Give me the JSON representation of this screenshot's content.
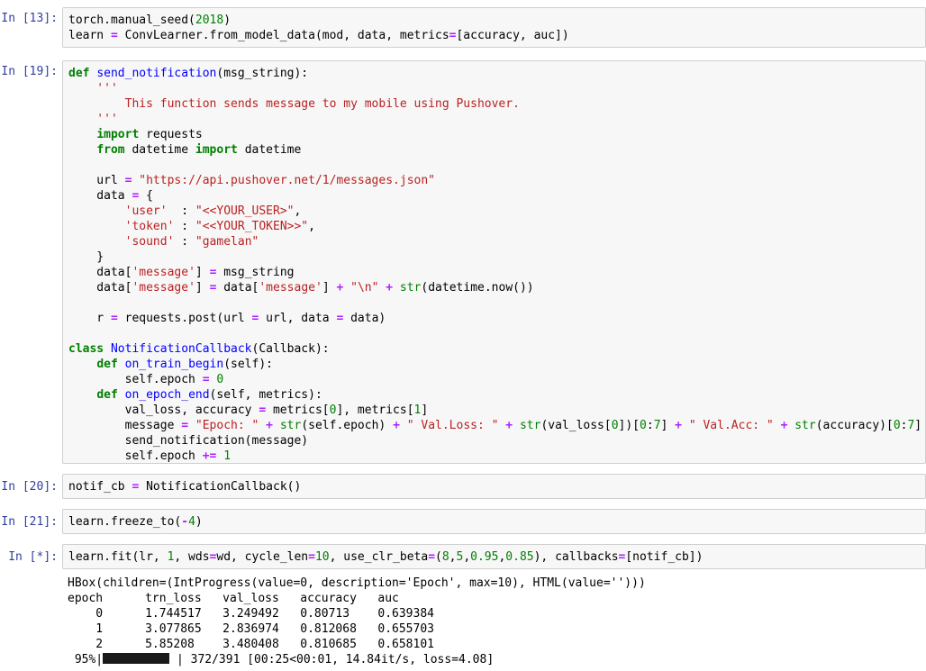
{
  "cells": [
    {
      "prompt": "In [13]:",
      "lines": [
        [
          [
            "",
            "torch.manual_seed("
          ],
          [
            "num",
            "2018"
          ],
          [
            "",
            ")"
          ]
        ],
        [
          [
            "",
            "learn "
          ],
          [
            "op",
            "="
          ],
          [
            "",
            " ConvLearner.from_model_data(mod, data, metrics"
          ],
          [
            "op",
            "="
          ],
          [
            "",
            "[accuracy, auc])"
          ]
        ]
      ]
    },
    {
      "prompt": "In [19]:",
      "lines": [
        [
          [
            "kw",
            "def"
          ],
          [
            "",
            " "
          ],
          [
            "nm",
            "send_notification"
          ],
          [
            "",
            "(msg_string):"
          ]
        ],
        [
          [
            "st",
            "    '''"
          ]
        ],
        [
          [
            "st",
            "        This function sends message to my mobile using Pushover."
          ]
        ],
        [
          [
            "st",
            "    '''"
          ]
        ],
        [
          [
            "",
            "    "
          ],
          [
            "kw",
            "import"
          ],
          [
            "",
            " requests"
          ]
        ],
        [
          [
            "",
            "    "
          ],
          [
            "kw",
            "from"
          ],
          [
            "",
            " datetime "
          ],
          [
            "kw",
            "import"
          ],
          [
            "",
            " datetime"
          ]
        ],
        [
          [
            "",
            ""
          ]
        ],
        [
          [
            "",
            "    url "
          ],
          [
            "op",
            "="
          ],
          [
            "",
            " "
          ],
          [
            "st",
            "\"https://api.pushover.net/1/messages.json\""
          ]
        ],
        [
          [
            "",
            "    data "
          ],
          [
            "op",
            "="
          ],
          [
            "",
            " {"
          ]
        ],
        [
          [
            "",
            "        "
          ],
          [
            "st",
            "'user'"
          ],
          [
            "",
            "  : "
          ],
          [
            "st",
            "\"<<YOUR_USER>\""
          ],
          [
            "",
            ","
          ]
        ],
        [
          [
            "",
            "        "
          ],
          [
            "st",
            "'token'"
          ],
          [
            "",
            " : "
          ],
          [
            "st",
            "\"<<YOUR_TOKEN>>\""
          ],
          [
            "",
            ","
          ]
        ],
        [
          [
            "",
            "        "
          ],
          [
            "st",
            "'sound'"
          ],
          [
            "",
            " : "
          ],
          [
            "st",
            "\"gamelan\""
          ]
        ],
        [
          [
            "",
            "    }"
          ]
        ],
        [
          [
            "",
            "    data["
          ],
          [
            "st",
            "'message'"
          ],
          [
            "",
            "] "
          ],
          [
            "op",
            "="
          ],
          [
            "",
            " msg_string"
          ]
        ],
        [
          [
            "",
            "    data["
          ],
          [
            "st",
            "'message'"
          ],
          [
            "",
            "] "
          ],
          [
            "op",
            "="
          ],
          [
            "",
            " data["
          ],
          [
            "st",
            "'message'"
          ],
          [
            "",
            "] "
          ],
          [
            "op",
            "+"
          ],
          [
            "",
            " "
          ],
          [
            "st",
            "\"\\n\""
          ],
          [
            "",
            " "
          ],
          [
            "op",
            "+"
          ],
          [
            "",
            " "
          ],
          [
            "bi",
            "str"
          ],
          [
            "",
            "(datetime.now())"
          ]
        ],
        [
          [
            "",
            ""
          ]
        ],
        [
          [
            "",
            "    r "
          ],
          [
            "op",
            "="
          ],
          [
            "",
            " requests.post(url "
          ],
          [
            "op",
            "="
          ],
          [
            "",
            " url, data "
          ],
          [
            "op",
            "="
          ],
          [
            "",
            " data)"
          ]
        ],
        [
          [
            "",
            ""
          ]
        ],
        [
          [
            "kw",
            "class"
          ],
          [
            "",
            " "
          ],
          [
            "cl",
            "NotificationCallback"
          ],
          [
            "",
            "(Callback):"
          ]
        ],
        [
          [
            "",
            "    "
          ],
          [
            "kw",
            "def"
          ],
          [
            "",
            " "
          ],
          [
            "nm",
            "on_train_begin"
          ],
          [
            "",
            "(self):"
          ]
        ],
        [
          [
            "",
            "        self.epoch "
          ],
          [
            "op",
            "="
          ],
          [
            "",
            " "
          ],
          [
            "num",
            "0"
          ]
        ],
        [
          [
            "",
            "    "
          ],
          [
            "kw",
            "def"
          ],
          [
            "",
            " "
          ],
          [
            "nm",
            "on_epoch_end"
          ],
          [
            "",
            "(self, metrics):"
          ]
        ],
        [
          [
            "",
            "        val_loss, accuracy "
          ],
          [
            "op",
            "="
          ],
          [
            "",
            " metrics["
          ],
          [
            "num",
            "0"
          ],
          [
            "",
            "], metrics["
          ],
          [
            "num",
            "1"
          ],
          [
            "",
            "]"
          ]
        ],
        [
          [
            "",
            "        message "
          ],
          [
            "op",
            "="
          ],
          [
            "",
            " "
          ],
          [
            "st",
            "\"Epoch: \""
          ],
          [
            "",
            " "
          ],
          [
            "op",
            "+"
          ],
          [
            "",
            " "
          ],
          [
            "bi",
            "str"
          ],
          [
            "",
            "(self.epoch) "
          ],
          [
            "op",
            "+"
          ],
          [
            "",
            " "
          ],
          [
            "st",
            "\" Val.Loss: \""
          ],
          [
            "",
            " "
          ],
          [
            "op",
            "+"
          ],
          [
            "",
            " "
          ],
          [
            "bi",
            "str"
          ],
          [
            "",
            "(val_loss["
          ],
          [
            "num",
            "0"
          ],
          [
            "",
            "])["
          ],
          [
            "num",
            "0"
          ],
          [
            "",
            ":"
          ],
          [
            "num",
            "7"
          ],
          [
            "",
            "] "
          ],
          [
            "op",
            "+"
          ],
          [
            "",
            " "
          ],
          [
            "st",
            "\" Val.Acc: \""
          ],
          [
            "",
            " "
          ],
          [
            "op",
            "+"
          ],
          [
            "",
            " "
          ],
          [
            "bi",
            "str"
          ],
          [
            "",
            "(accuracy)["
          ],
          [
            "num",
            "0"
          ],
          [
            "",
            ":"
          ],
          [
            "num",
            "7"
          ],
          [
            "",
            "]"
          ]
        ],
        [
          [
            "",
            "        send_notification(message)"
          ]
        ],
        [
          [
            "",
            "        self.epoch "
          ],
          [
            "op",
            "+="
          ],
          [
            "",
            " "
          ],
          [
            "num",
            "1"
          ]
        ]
      ]
    },
    {
      "prompt": "In [20]:",
      "lines": [
        [
          [
            "",
            "notif_cb "
          ],
          [
            "op",
            "="
          ],
          [
            "",
            " NotificationCallback()"
          ]
        ]
      ]
    },
    {
      "prompt": "In [21]:",
      "lines": [
        [
          [
            "",
            "learn.freeze_to("
          ],
          [
            "op",
            "-"
          ],
          [
            "num",
            "4"
          ],
          [
            "",
            ")"
          ]
        ]
      ]
    },
    {
      "prompt": "In [*]:",
      "lines": [
        [
          [
            "",
            "learn.fit(lr, "
          ],
          [
            "num",
            "1"
          ],
          [
            "",
            ", wds"
          ],
          [
            "op",
            "="
          ],
          [
            "",
            "wd, cycle_len"
          ],
          [
            "op",
            "="
          ],
          [
            "num",
            "10"
          ],
          [
            "",
            ", use_clr_beta"
          ],
          [
            "op",
            "="
          ],
          [
            "",
            "("
          ],
          [
            "num",
            "8"
          ],
          [
            "",
            ","
          ],
          [
            "num",
            "5"
          ],
          [
            "",
            ","
          ],
          [
            "num",
            "0.95"
          ],
          [
            "",
            ","
          ],
          [
            "num",
            "0.85"
          ],
          [
            "",
            "), callbacks"
          ],
          [
            "op",
            "="
          ],
          [
            "",
            "[notif_cb])"
          ]
        ]
      ]
    }
  ],
  "output": {
    "hbox": "HBox(children=(IntProgress(value=0, description='Epoch', max=10), HTML(value='')))",
    "header": "epoch      trn_loss   val_loss   accuracy   auc",
    "rows": [
      "    0      1.744517   3.249492   0.80713    0.639384",
      "    1      3.077865   2.836974   0.812068   0.655703",
      "    2      5.85208    3.480408   0.810685   0.658101"
    ],
    "progress_pct": " 95%|",
    "progress_fraction": 0.95,
    "progress_rest": " | 372/391 [00:25<00:01, 14.84it/s, loss=4.08]"
  }
}
